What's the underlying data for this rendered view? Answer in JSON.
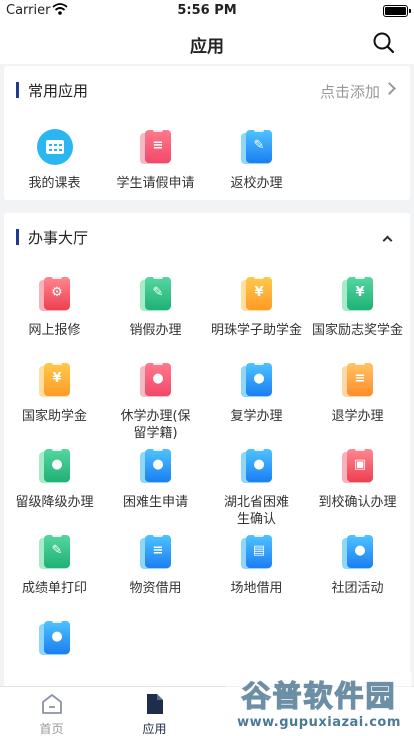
{
  "statusbar": {
    "carrier": "Carrier",
    "time": "5:56 PM"
  },
  "navbar": {
    "title": "应用"
  },
  "common": {
    "title": "常用应用",
    "add_label": "点击添加",
    "items": [
      {
        "label": "我的课表",
        "icon": "calendar-icon",
        "color": "round"
      },
      {
        "label": "学生请假申请",
        "icon": "leave-form-icon",
        "color": "c-pink"
      },
      {
        "label": "返校办理",
        "icon": "return-school-icon",
        "color": "c-blue"
      }
    ]
  },
  "hall": {
    "title": "办事大厅",
    "items": [
      {
        "label": "网上报修",
        "icon": "repair-icon",
        "color": "c-red",
        "sym": "⚙"
      },
      {
        "label": "销假办理",
        "icon": "cancel-leave-icon",
        "color": "c-green",
        "sym": "✎"
      },
      {
        "label": "明珠学子助学金",
        "icon": "scholarship-icon",
        "color": "c-gold",
        "sym": "¥"
      },
      {
        "label": "国家励志奖学金",
        "icon": "national-award-icon",
        "color": "c-green",
        "sym": "¥"
      },
      {
        "label": "国家助学金",
        "icon": "national-grant-icon",
        "color": "c-gold",
        "sym": "¥"
      },
      {
        "label": "休学办理(保留学籍)",
        "icon": "suspend-study-icon",
        "color": "c-pink",
        "sym": "●"
      },
      {
        "label": "复学办理",
        "icon": "resume-study-icon",
        "color": "c-blue",
        "sym": "●"
      },
      {
        "label": "退学办理",
        "icon": "withdraw-icon",
        "color": "c-orange",
        "sym": "≡"
      },
      {
        "label": "留级降级办理",
        "icon": "repeat-grade-icon",
        "color": "c-green",
        "sym": "●"
      },
      {
        "label": "困难生申请",
        "icon": "hardship-apply-icon",
        "color": "c-blue",
        "sym": "●"
      },
      {
        "label": "湖北省困难生确认",
        "icon": "hubei-hardship-icon",
        "color": "c-blue",
        "sym": "●"
      },
      {
        "label": "到校确认办理",
        "icon": "arrival-confirm-icon",
        "color": "c-red",
        "sym": "▣"
      },
      {
        "label": "成绩单打印",
        "icon": "transcript-print-icon",
        "color": "c-green",
        "sym": "✎"
      },
      {
        "label": "物资借用",
        "icon": "materials-borrow-icon",
        "color": "c-blue",
        "sym": "≡"
      },
      {
        "label": "场地借用",
        "icon": "venue-borrow-icon",
        "color": "c-blue",
        "sym": "▤"
      },
      {
        "label": "社团活动",
        "icon": "club-activity-icon",
        "color": "c-blue",
        "sym": "●"
      },
      {
        "label": "",
        "icon": "student-icon",
        "color": "c-blue",
        "sym": "●"
      }
    ]
  },
  "tabbar": {
    "tabs": [
      {
        "label": "首页",
        "icon": "home-icon"
      },
      {
        "label": "应用",
        "icon": "apps-document-icon"
      }
    ]
  },
  "watermark": {
    "text": "谷普软件园",
    "url": "www.gupuxiazai.com"
  },
  "colors": {
    "accent": "#1f3a8a",
    "background": "#f2f3f5"
  }
}
